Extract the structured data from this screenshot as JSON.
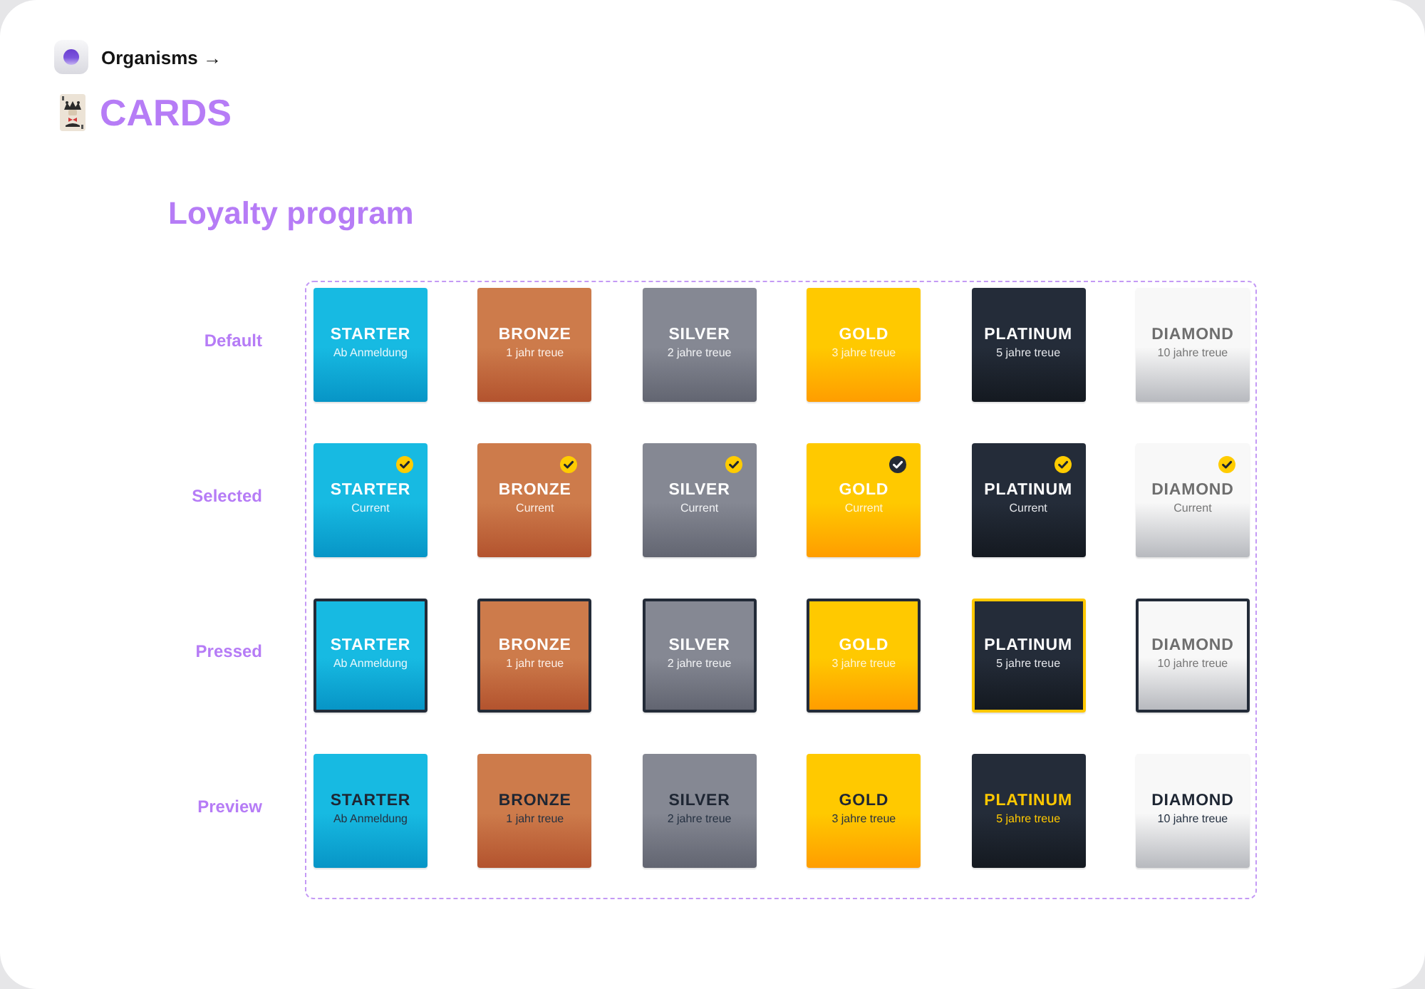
{
  "breadcrumb": "Organisms →",
  "page_title": "CARDS",
  "section_title": "Loyalty program",
  "states": [
    {
      "label": "Default",
      "kind": "default",
      "cards": [
        {
          "kind": "starter",
          "title": "STARTER",
          "subtitle": "Ab Anmeldung"
        },
        {
          "kind": "bronze",
          "title": "BRONZE",
          "subtitle": "1 jahr treue"
        },
        {
          "kind": "silver",
          "title": "SILVER",
          "subtitle": "2 jahre treue"
        },
        {
          "kind": "gold",
          "title": "GOLD",
          "subtitle": "3 jahre treue"
        },
        {
          "kind": "platinum",
          "title": "PLATINUM",
          "subtitle": "5 jahre treue"
        },
        {
          "kind": "diamond",
          "title": "DIAMOND",
          "subtitle": "10 jahre treue"
        }
      ]
    },
    {
      "label": "Selected",
      "kind": "selected",
      "cards": [
        {
          "kind": "starter",
          "title": "STARTER",
          "subtitle": "Current"
        },
        {
          "kind": "bronze",
          "title": "BRONZE",
          "subtitle": "Current"
        },
        {
          "kind": "silver",
          "title": "SILVER",
          "subtitle": "Current"
        },
        {
          "kind": "gold",
          "title": "GOLD",
          "subtitle": "Current"
        },
        {
          "kind": "platinum",
          "title": "PLATINUM",
          "subtitle": "Current"
        },
        {
          "kind": "diamond",
          "title": "DIAMOND",
          "subtitle": "Current"
        }
      ]
    },
    {
      "label": "Pressed",
      "kind": "pressed",
      "cards": [
        {
          "kind": "starter",
          "title": "STARTER",
          "subtitle": "Ab Anmeldung"
        },
        {
          "kind": "bronze",
          "title": "BRONZE",
          "subtitle": "1 jahr treue"
        },
        {
          "kind": "silver",
          "title": "SILVER",
          "subtitle": "2 jahre treue"
        },
        {
          "kind": "gold",
          "title": "GOLD",
          "subtitle": "3 jahre treue"
        },
        {
          "kind": "platinum",
          "title": "PLATINUM",
          "subtitle": "5 jahre treue"
        },
        {
          "kind": "diamond",
          "title": "DIAMOND",
          "subtitle": "10 jahre treue"
        }
      ]
    },
    {
      "label": "Preview",
      "kind": "preview",
      "cards": [
        {
          "kind": "starter",
          "title": "STARTER",
          "subtitle": "Ab Anmeldung"
        },
        {
          "kind": "bronze",
          "title": "BRONZE",
          "subtitle": "1 jahr treue"
        },
        {
          "kind": "silver",
          "title": "SILVER",
          "subtitle": "2 jahre treue"
        },
        {
          "kind": "gold",
          "title": "GOLD",
          "subtitle": "3 jahre treue"
        },
        {
          "kind": "platinum",
          "title": "PLATINUM",
          "subtitle": "5 jahre treue"
        },
        {
          "kind": "diamond",
          "title": "DIAMOND",
          "subtitle": "10 jahre treue"
        }
      ]
    }
  ]
}
